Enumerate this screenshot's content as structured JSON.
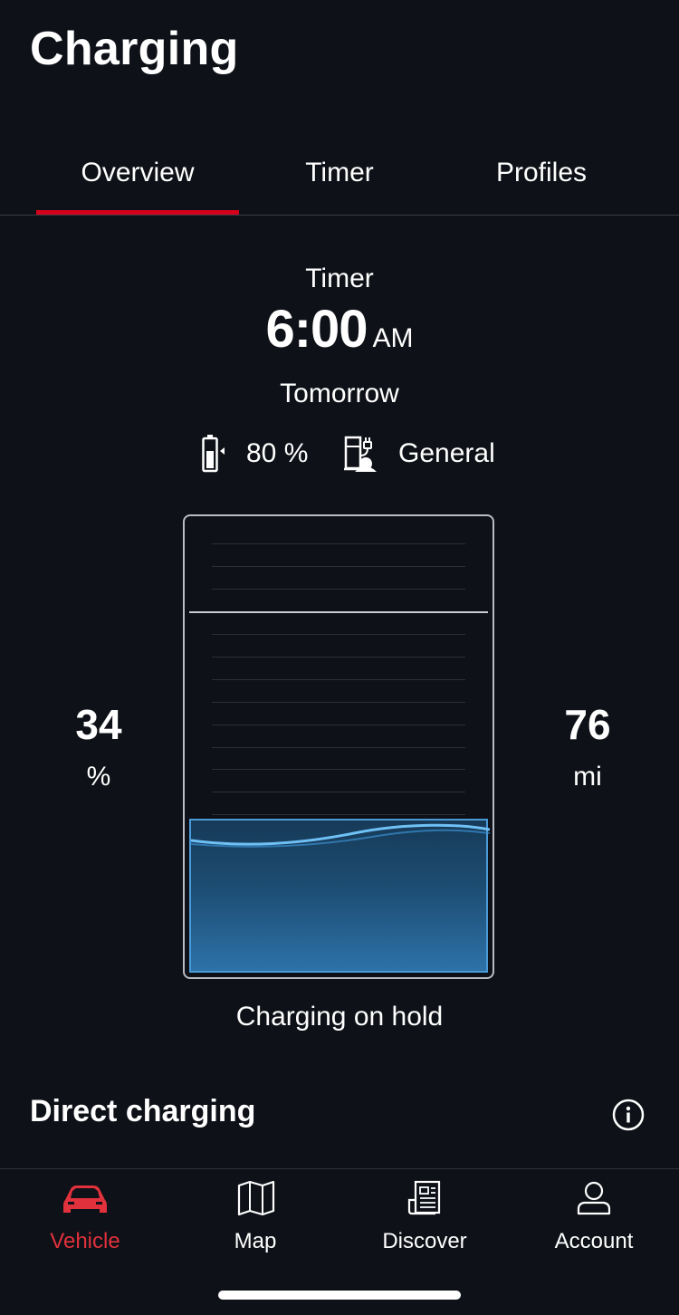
{
  "header": {
    "title": "Charging"
  },
  "tabs": [
    {
      "label": "Overview",
      "active": true
    },
    {
      "label": "Timer",
      "active": false
    },
    {
      "label": "Profiles",
      "active": false
    }
  ],
  "timer": {
    "label": "Timer",
    "time": "6:00",
    "ampm": "AM",
    "day": "Tomorrow"
  },
  "info": {
    "target_charge": "80 %",
    "target_charge_icon": "battery-charge-icon",
    "profile": "General",
    "profile_icon": "charging-station-icon"
  },
  "state": {
    "charge_percent": "34",
    "charge_unit": "%",
    "range_value": "76",
    "range_unit": "mi",
    "fill_fraction": 0.34,
    "target_fraction": 0.8,
    "status": "Charging on hold"
  },
  "direct_charging": {
    "title": "Direct charging",
    "info_icon": "info-icon"
  },
  "bottom_nav": [
    {
      "label": "Vehicle",
      "icon": "car-icon",
      "active": true
    },
    {
      "label": "Map",
      "icon": "map-icon",
      "active": false
    },
    {
      "label": "Discover",
      "icon": "news-icon",
      "active": false
    },
    {
      "label": "Account",
      "icon": "user-icon",
      "active": false
    }
  ],
  "colors": {
    "background": "#0e1117",
    "accent_red": "#d5001c",
    "fill_blue": "#2d72a8",
    "nav_active": "#e0313c"
  }
}
